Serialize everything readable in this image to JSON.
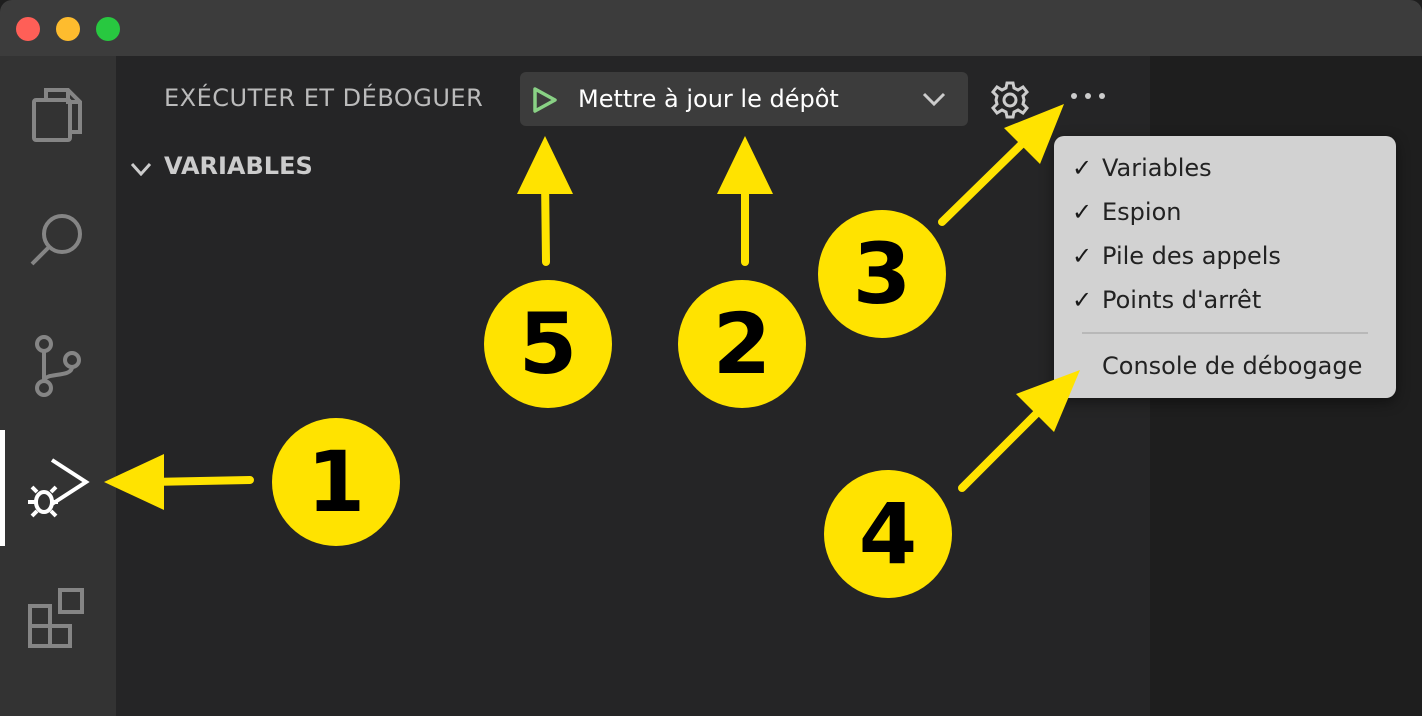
{
  "sidebar": {
    "title": "EXÉCUTER ET DÉBOGUER",
    "config_dropdown": {
      "selected": "Mettre à jour le dépôt"
    },
    "section_header": "VARIABLES"
  },
  "activity_bar": {
    "icons": [
      "explorer-icon",
      "search-icon",
      "source-control-icon",
      "run-debug-icon",
      "extensions-icon"
    ],
    "active": "run-debug-icon"
  },
  "more_menu": {
    "items": [
      {
        "label": "Variables",
        "check": "✓"
      },
      {
        "label": "Espion",
        "check": "✓"
      },
      {
        "label": "Pile des appels",
        "check": "✓"
      },
      {
        "label": "Points d'arrêt",
        "check": "✓"
      },
      {
        "label": "Console de débogage",
        "check": ""
      }
    ]
  },
  "annotations": {
    "badges": [
      "1",
      "2",
      "3",
      "4",
      "5"
    ],
    "color": "#ffe300"
  },
  "colors": {
    "titlebar": "#3c3c3c",
    "activity_bar": "#333333",
    "sidebar": "#252526",
    "play_green": "#89d185",
    "menu_bg": "#d2d2d2"
  }
}
